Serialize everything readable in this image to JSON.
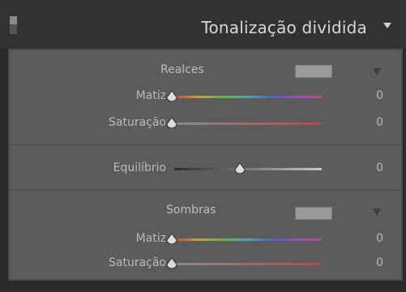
{
  "header": {
    "title": "Tonalização dividida"
  },
  "highlights": {
    "title": "Realces",
    "swatch_color": "#9a9a9a",
    "hue_label": "Matiz",
    "hue_value": "0",
    "saturation_label": "Saturação",
    "saturation_value": "0"
  },
  "balance": {
    "label": "Equilíbrio",
    "value": "0"
  },
  "shadows": {
    "title": "Sombras",
    "swatch_color": "#9a9a9a",
    "hue_label": "Matiz",
    "hue_value": "0",
    "saturation_label": "Saturação",
    "saturation_value": "0"
  }
}
